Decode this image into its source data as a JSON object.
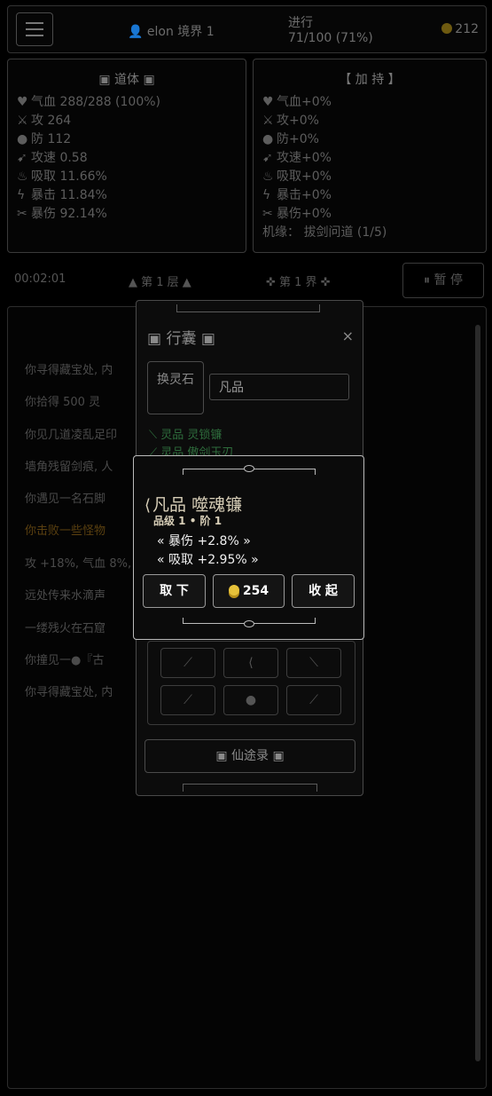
{
  "topbar": {
    "user": "elon 境界 1",
    "progress_label": "进行",
    "progress_value": "71/100 (71%)",
    "coins": "212"
  },
  "left_panel": {
    "title": "▣ 道体 ▣",
    "stats": [
      {
        "icon": "heart-icon",
        "glyph": "♥",
        "text": "气血 288/288 (100%)"
      },
      {
        "icon": "sword-icon",
        "glyph": "⚔",
        "text": "攻 264"
      },
      {
        "icon": "shield-icon",
        "glyph": "●",
        "text": "防 112"
      },
      {
        "icon": "speed-icon",
        "glyph": "➹",
        "text": "攻速 0.58"
      },
      {
        "icon": "absorb-icon",
        "glyph": "♨",
        "text": "吸取 11.66%"
      },
      {
        "icon": "crit-icon",
        "glyph": "ϟ",
        "text": "暴击 11.84%"
      },
      {
        "icon": "critdmg-icon",
        "glyph": "✂",
        "text": "暴伤 92.14%"
      }
    ]
  },
  "right_panel": {
    "title": "【 加 持 】",
    "stats": [
      {
        "icon": "heart-icon",
        "glyph": "♥",
        "text": "气血+0%"
      },
      {
        "icon": "sword-icon",
        "glyph": "⚔",
        "text": "攻+0%"
      },
      {
        "icon": "shield-icon",
        "glyph": "●",
        "text": "防+0%"
      },
      {
        "icon": "speed-icon",
        "glyph": "➹",
        "text": "攻速+0%"
      },
      {
        "icon": "absorb-icon",
        "glyph": "♨",
        "text": "吸取+0%"
      },
      {
        "icon": "crit-icon",
        "glyph": "ϟ",
        "text": "暴击+0%"
      },
      {
        "icon": "critdmg-icon",
        "glyph": "✂",
        "text": "暴伤+0%"
      }
    ],
    "footer": "机缘： 拔剑问道 (1/5)"
  },
  "status_row": {
    "timer": "00:02:01",
    "floor": "▲ 第 1 层 ▲",
    "world": "✜ 第 1 界 ✜",
    "pause": "⏸ 暂 停"
  },
  "log": [
    "你寻得藏宝处, 内",
    "你拾得 500 灵",
    "你见几道凌乱足印",
    "墙角残留剑痕, 人",
    "你遇见一名石脚",
    "你击败一些怪物",
    "攻 +18%, 气血                                                    8%,",
    "远处传来水滴声",
    "一缕残火在石窟",
    "你撞见一●『古",
    "你寻得藏宝处, 内"
  ],
  "bag": {
    "title": "▣ 行囊 ▣",
    "close": "×",
    "swap_label": "换灵石",
    "filter_value": "凡品",
    "items": [
      "⟍ 灵品 灵锁镰",
      "⟋ 灵品 傲剑玉刃"
    ],
    "slots": [
      "⟋",
      "⟨",
      "⟍",
      "⟋",
      "●",
      "⟋"
    ],
    "record_label": "▣ 仙途录 ▣"
  },
  "tooltip": {
    "sickle_icon": "sickle-icon",
    "name": "凡品 噬魂镰",
    "grade": "品级 1 • 阶 1",
    "attrs": [
      "« 暴伤 +2.8% »",
      "« 吸取 +2.95% »"
    ],
    "unequip_label": "取 下",
    "price": "254",
    "collect_label": "收 起"
  }
}
